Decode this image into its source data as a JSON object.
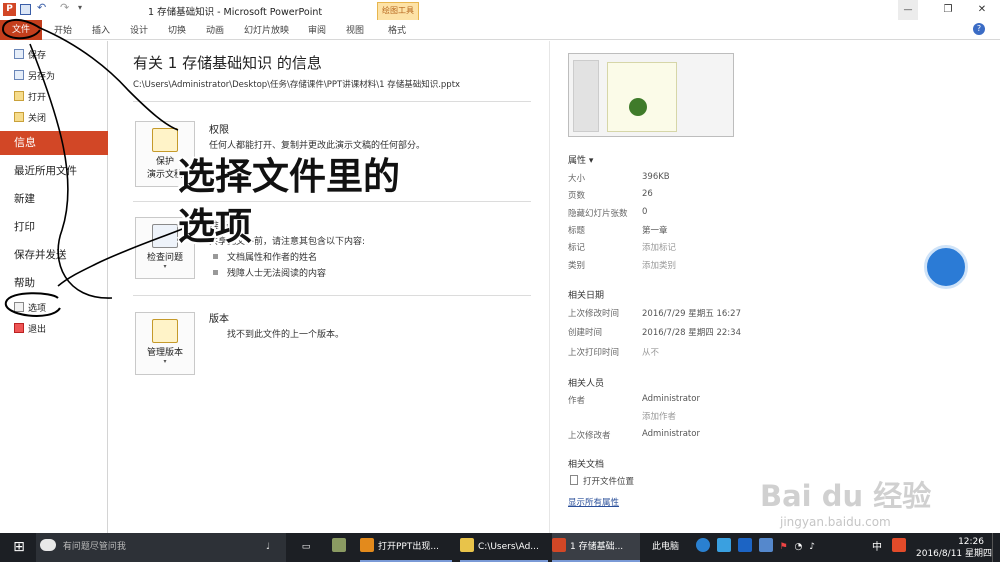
{
  "titlebar": {
    "title": "1  存储基础知识 - Microsoft PowerPoint",
    "context_group": "绘图工具",
    "minimize": "—",
    "restore": "❐",
    "close": "✕"
  },
  "ribbon_tabs": [
    "文件",
    "开始",
    "插入",
    "设计",
    "切换",
    "动画",
    "幻灯片放映",
    "审阅",
    "视图",
    "格式"
  ],
  "sidebar": {
    "small_items": [
      "保存",
      "另存为",
      "打开",
      "关闭"
    ],
    "active_item": "信息",
    "big_items": [
      "最近所用文件",
      "新建",
      "打印",
      "保存并发送",
      "帮助"
    ],
    "bottom_items": [
      "选项",
      "退出"
    ]
  },
  "main": {
    "heading": "有关 1  存储基础知识 的信息",
    "path": "C:\\Users\\Administrator\\Desktop\\任务\\存储课件\\PPT讲课材料\\1  存储基础知识.pptx",
    "sections": [
      {
        "button": "保护\n演示文稿",
        "button_line1": "保护",
        "button_line2": "演示文稿",
        "title": "权限",
        "text": "任何人都能打开、复制并更改此演示文稿的任何部分。"
      },
      {
        "button_line1": "检查问题",
        "title": "准备共享",
        "text": "共享此文件前，请注意其包含以下内容:",
        "bullets": [
          "文档属性和作者的姓名",
          "残障人士无法阅读的内容"
        ]
      },
      {
        "button_line1": "管理版本",
        "title": "版本",
        "text": "找不到此文件的上一个版本。"
      }
    ]
  },
  "properties": {
    "header": "属性 ▾",
    "rows": [
      {
        "k": "大小",
        "v": "396KB"
      },
      {
        "k": "页数",
        "v": "26"
      },
      {
        "k": "隐藏幻灯片张数",
        "v": "0"
      },
      {
        "k": "标题",
        "v": "第一章"
      },
      {
        "k": "标记",
        "v": "添加标记"
      },
      {
        "k": "类别",
        "v": "添加类别"
      }
    ],
    "dates_header": "相关日期",
    "dates": [
      {
        "k": "上次修改时间",
        "v": "2016/7/29 星期五 16:27"
      },
      {
        "k": "创建时间",
        "v": "2016/7/28 星期四 22:34"
      },
      {
        "k": "上次打印时间",
        "v": "从不"
      }
    ],
    "people_header": "相关人员",
    "author_label": "作者",
    "author": "Administrator",
    "add_author": "添加作者",
    "last_modified_by_label": "上次修改者",
    "last_modified_by": "Administrator",
    "docs_header": "相关文档",
    "open_location": "打开文件位置",
    "show_all": "显示所有属性"
  },
  "overlay": {
    "line1": "选择文件里的",
    "line2": "选项"
  },
  "watermark": {
    "brand": "Bai du 经验",
    "url": "jingyan.baidu.com"
  },
  "taskbar": {
    "search_placeholder": "有问题尽管问我",
    "windows": [
      "打开PPT出现...",
      "C:\\Users\\Ad...",
      "1  存储基础..."
    ],
    "this_pc": "此电脑",
    "ime": "中",
    "time": "12:26",
    "date": "2016/8/11 星期四"
  },
  "colors": {
    "accent": "#d24726",
    "file_tab": "#c43e1c",
    "context_tab": "#fde2a6",
    "taskbar": "#1c1f24"
  }
}
